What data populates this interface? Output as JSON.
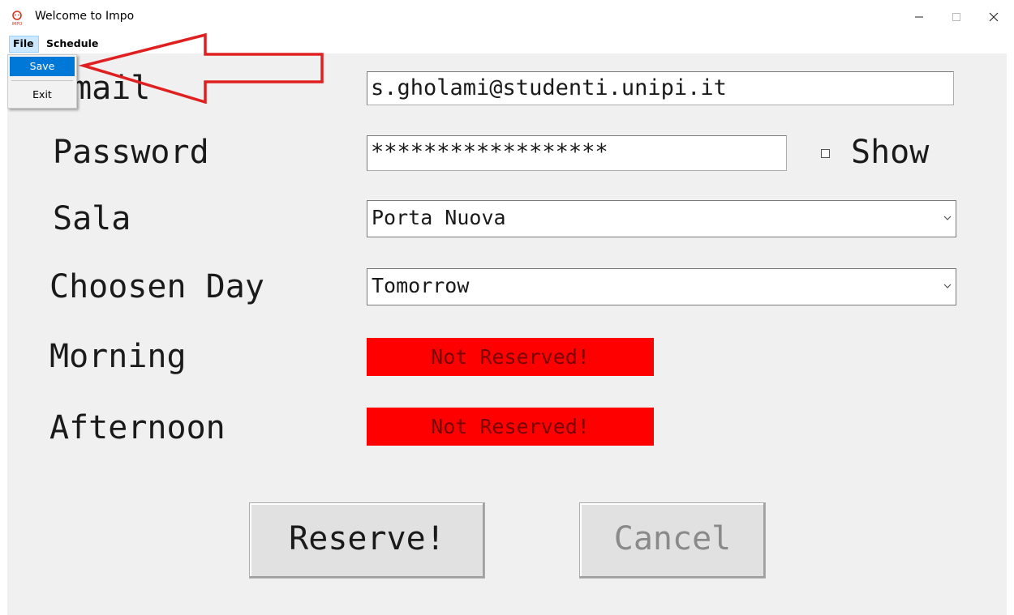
{
  "window": {
    "title": "Welcome to Impo",
    "icon_name": "impo-app-icon",
    "controls": [
      "minimize-icon",
      "maximize-icon",
      "close-icon"
    ]
  },
  "menubar": {
    "items": [
      {
        "label": "File",
        "active": true
      },
      {
        "label": "Schedule",
        "active": false
      }
    ]
  },
  "file_menu": {
    "items": [
      {
        "label": "Save",
        "highlighted": true
      },
      {
        "label": "Exit",
        "highlighted": false
      }
    ]
  },
  "form": {
    "email": {
      "label": "Email",
      "value": "s.gholami@studenti.unipi.it"
    },
    "password": {
      "label": "Password",
      "value": "******************",
      "show_label": "Show",
      "show_checked": false
    },
    "sala": {
      "label": "Sala",
      "value": "Porta Nuova"
    },
    "day": {
      "label": "Choosen Day",
      "value": "Tomorrow"
    },
    "morning": {
      "label": "Morning",
      "status": "Not Reserved!"
    },
    "afternoon": {
      "label": "Afternoon",
      "status": "Not Reserved!"
    }
  },
  "buttons": {
    "reserve": "Reserve!",
    "cancel": "Cancel"
  },
  "colors": {
    "status_not_reserved": "#ff0000",
    "menu_highlight": "#0078d7",
    "annotation_arrow": "#e02020",
    "content_bg": "#f0f0f0"
  }
}
